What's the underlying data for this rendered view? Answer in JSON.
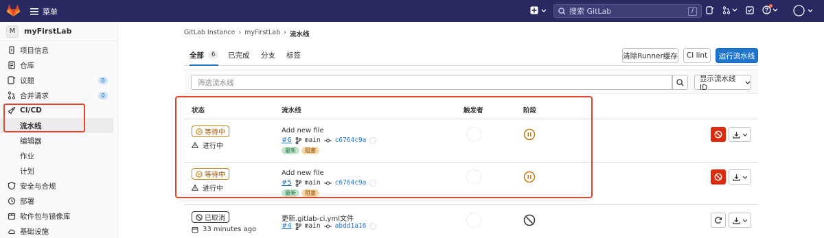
{
  "topbar": {
    "menu_label": "菜单",
    "search_placeholder": "搜索 GitLab",
    "search_shortcut": "/"
  },
  "sidebar": {
    "project_avatar": "M",
    "project_name": "myFirstLab",
    "items": [
      {
        "label": "项目信息",
        "icon": "info-icon"
      },
      {
        "label": "仓库",
        "icon": "doc-icon"
      },
      {
        "label": "议题",
        "icon": "issues-icon",
        "count": "0"
      },
      {
        "label": "合并请求",
        "icon": "merge-request-icon",
        "count": "0"
      },
      {
        "label": "CI/CD",
        "icon": "rocket-icon"
      }
    ],
    "cicd_sub": [
      "流水线",
      "编辑器",
      "作业",
      "计划"
    ],
    "items_after": [
      {
        "label": "安全与合规",
        "icon": "shield-icon"
      },
      {
        "label": "部署",
        "icon": "deploy-icon"
      },
      {
        "label": "软件包与镜像库",
        "icon": "package-icon"
      },
      {
        "label": "基础设施",
        "icon": "cloud-icon"
      }
    ]
  },
  "breadcrumb": [
    "GitLab Instance",
    "myFirstLab",
    "流水线"
  ],
  "tabs": [
    {
      "label": "全部",
      "count": "6"
    },
    {
      "label": "已完成"
    },
    {
      "label": "分支"
    },
    {
      "label": "标签"
    }
  ],
  "buttons": {
    "clear_runner": "清除Runner缓存",
    "ci_lint": "CI lint",
    "run_pipeline": "运行流水线"
  },
  "filter": {
    "placeholder": "筛选流水线",
    "dropdown_label": "显示流水线ID"
  },
  "table": {
    "headers": [
      "状态",
      "流水线",
      "触发者",
      "阶段"
    ],
    "rows": [
      {
        "status": "等待中",
        "status_sub": "进行中",
        "title": "Add new file",
        "id": "#6",
        "branch": "main",
        "sha": "c6764c9a",
        "tags": [
          "最新",
          "阻塞"
        ]
      },
      {
        "status": "等待中",
        "status_sub": "进行中",
        "title": "Add new file",
        "id": "#5",
        "branch": "main",
        "sha": "c6764c9a",
        "tags": [
          "最新",
          "阻塞"
        ]
      },
      {
        "status": "已取消",
        "status_sub": "33 minutes ago",
        "title": "更新.gitlab-ci.yml文件",
        "id": "#4",
        "branch": "main",
        "sha": "abdd1a16",
        "tags": []
      }
    ]
  },
  "colors": {
    "topbar": "#292961",
    "primary": "#1f75cb",
    "danger": "#dd2b0e",
    "highlight": "#e24329",
    "pending": "#c17d10"
  }
}
